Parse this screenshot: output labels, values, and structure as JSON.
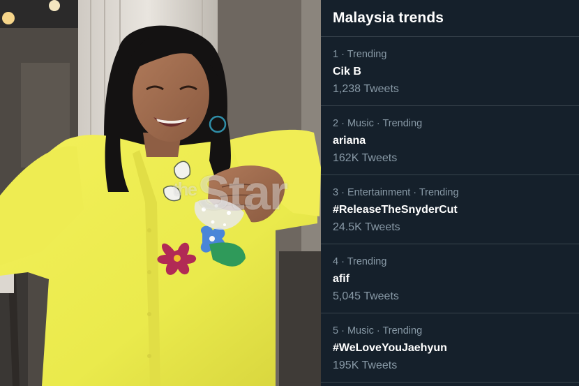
{
  "photo": {
    "watermark_prefix": "the",
    "watermark_text": "Star"
  },
  "panel": {
    "title": "Malaysia trends",
    "trends": [
      {
        "meta": "1 · Trending",
        "name": "Cik B",
        "count": "1,238 Tweets"
      },
      {
        "meta": "2 · Music · Trending",
        "name": "ariana",
        "count": "162K Tweets"
      },
      {
        "meta": "3 · Entertainment · Trending",
        "name": "#ReleaseTheSnyderCut",
        "count": "24.5K Tweets"
      },
      {
        "meta": "4 · Trending",
        "name": "afif",
        "count": "5,045 Tweets"
      },
      {
        "meta": "5 · Music · Trending",
        "name": "#WeLoveYouJaehyun",
        "count": "195K Tweets"
      }
    ]
  }
}
